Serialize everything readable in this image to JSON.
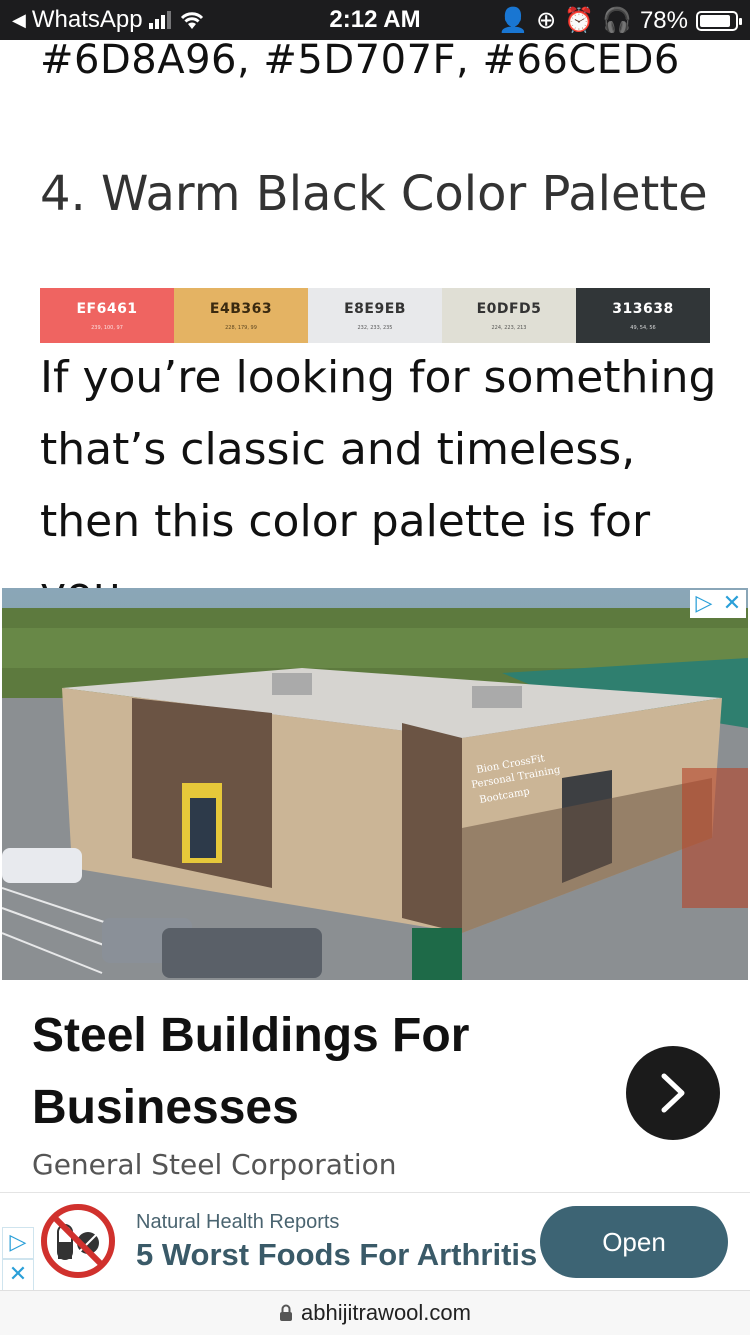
{
  "status_bar": {
    "back_app": "WhatsApp",
    "time": "2:12 AM",
    "battery": "78%"
  },
  "article": {
    "previous_colors": "#6D8A96, #5D707F, #66CED6",
    "heading": "4. Warm Black Color Palette",
    "palette": [
      {
        "hex": "EF6461",
        "rgb": "239, 100, 97",
        "color": "#EF6461",
        "text_color": "#ffffff"
      },
      {
        "hex": "E4B363",
        "rgb": "228, 179, 99",
        "color": "#E4B363",
        "text_color": "#3a2a10"
      },
      {
        "hex": "E8E9EB",
        "rgb": "232, 233, 235",
        "color": "#E8E9EB",
        "text_color": "#333333"
      },
      {
        "hex": "E0DFD5",
        "rgb": "224, 223, 213",
        "color": "#E0DFD5",
        "text_color": "#333333"
      },
      {
        "hex": "313638",
        "rgb": "49, 54, 56",
        "color": "#313638",
        "text_color": "#ffffff"
      }
    ],
    "paragraph": "If you’re looking for something that’s classic and timeless, then this color palette is for you."
  },
  "ad": {
    "sign_text": "Bion CrossFit Personal Training Bootcamp",
    "title": "Steel Buildings For Businesses",
    "sponsor": "General Steel Corporation",
    "adchoices_icon": "adchoices-icon",
    "close_icon": "close-icon"
  },
  "banner_ad": {
    "source": "Natural Health Reports",
    "title": "5 Worst Foods For Arthritis",
    "button": "Open",
    "accent": "#3d6474"
  },
  "url_bar": {
    "domain": "abhijitrawool.com"
  }
}
